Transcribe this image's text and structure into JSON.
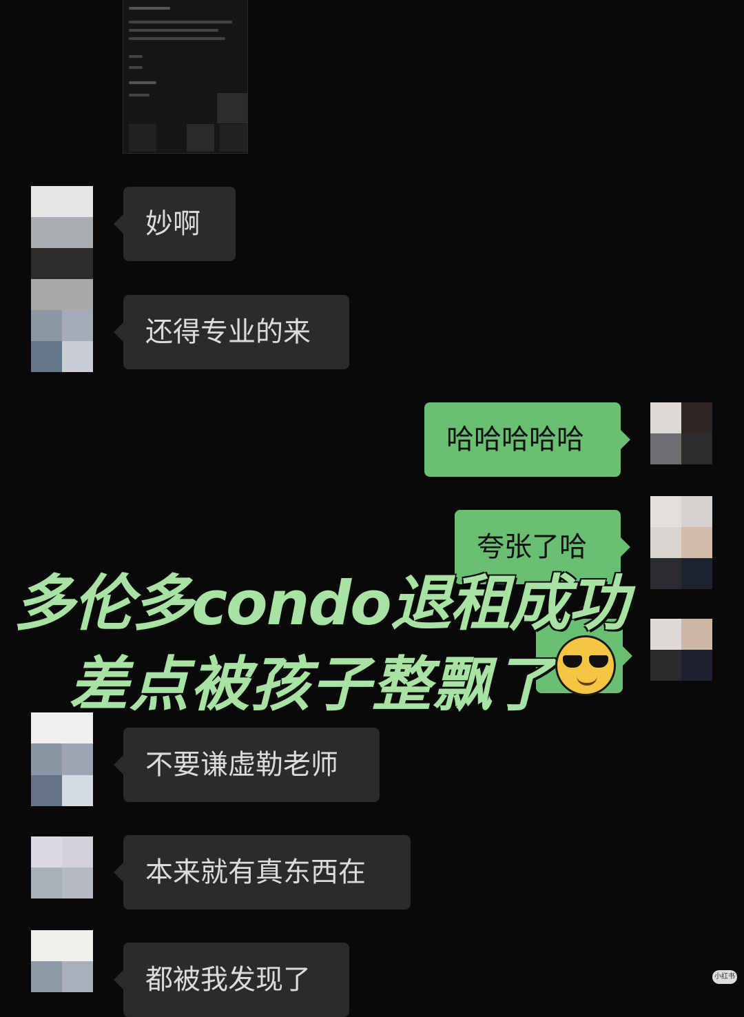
{
  "chat": {
    "messages": [
      {
        "side": "left",
        "text": "妙啊"
      },
      {
        "side": "left",
        "text": "还得专业的来"
      },
      {
        "side": "right",
        "text": "哈哈哈哈哈"
      },
      {
        "side": "right",
        "text": "夸张了哈"
      },
      {
        "side": "right",
        "text": ""
      },
      {
        "side": "left",
        "text": "不要谦虚勒老师"
      },
      {
        "side": "left",
        "text": "本来就有真东西在"
      },
      {
        "side": "left",
        "text": "都被我发现了"
      }
    ]
  },
  "overlay": {
    "line1": "多伦多condo退租成功",
    "line2": "差点被孩子整飘了"
  },
  "icons": {
    "emoji": "smiling-face-with-sunglasses-emoji"
  },
  "colors": {
    "background": "#090909",
    "incoming_bubble": "#2b2b2b",
    "outgoing_bubble": "#6abf73",
    "overlay_text": "#a9e3a3"
  },
  "watermark": {
    "text": "小红书"
  }
}
